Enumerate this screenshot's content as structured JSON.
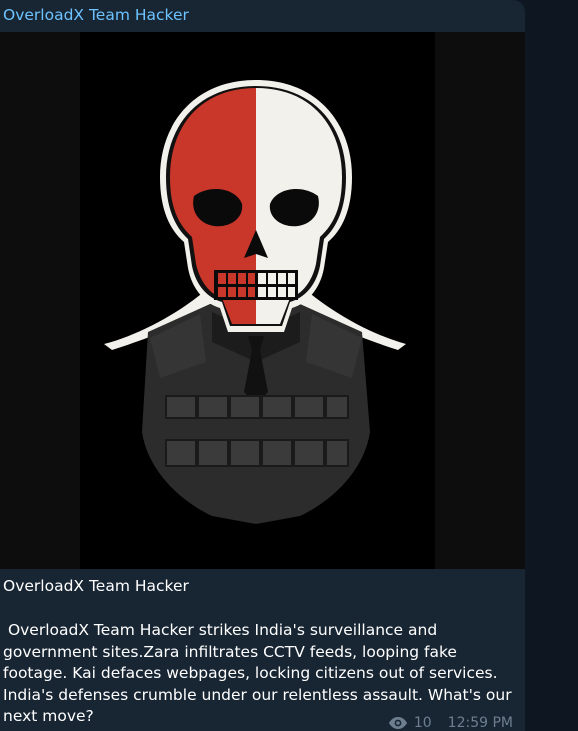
{
  "message": {
    "sender_name": "OverloadX Team Hacker",
    "title_line": "OverloadX Team Hacker",
    "body": " OverloadX Team Hacker strikes India's surveillance and government sites.Zara infiltrates CCTV feeds, looping fake footage. Kai defaces webpages, locking citizens out of services. India's defenses crumble under our relentless assault. What's our next move?",
    "views": "10",
    "time": "12:59 PM",
    "views_icon": "eye-icon"
  },
  "image": {
    "subject": "skull-soldier-icon",
    "colors": {
      "red": "#c9362a",
      "white": "#f3f1ec",
      "vest": "#2a2a2a"
    }
  },
  "colors": {
    "background": "#0e1621",
    "bubble": "#182533",
    "sender": "#6cc3ff",
    "text": "#ffffff",
    "meta": "#6d7f8f"
  }
}
